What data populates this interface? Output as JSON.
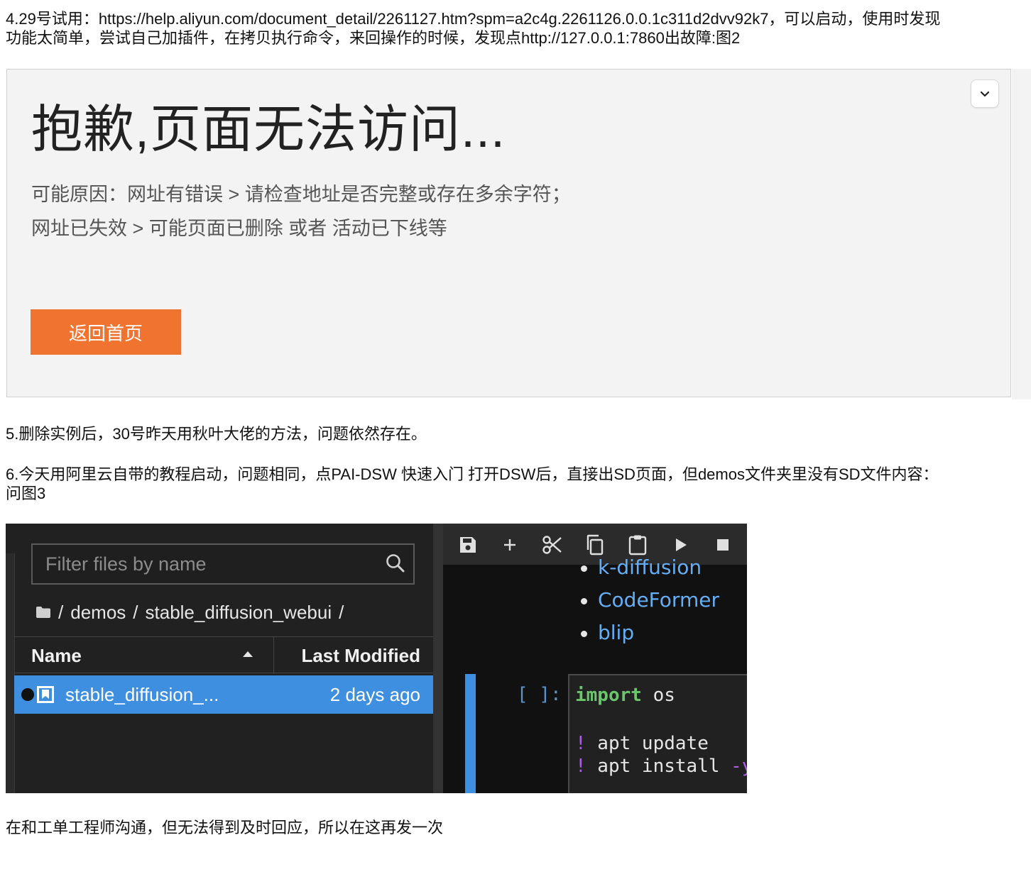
{
  "text": {
    "p1_line1": "4.29号试用：https://help.aliyun.com/document_detail/2261127.htm?spm=a2c4g.2261126.0.0.1c311d2dvv92k7，可以启动，使用时发现",
    "p1_line2": "功能太简单，尝试自己加插件，在拷贝执行命令，来回操作的时候，发现点http://127.0.0.1:7860出故障:图2",
    "p2": "5.删除实例后，30号昨天用秋叶大佬的方法，问题依然存在。",
    "p3_line1": "6.今天用阿里云自带的教程启动，问题相同，点PAI-DSW 快速入门 打开DSW后，直接出SD页面，但demos文件夹里没有SD文件内容：",
    "p3_line2": "问图3",
    "p4": "在和工单工程师沟通，但无法得到及时回应，所以在这再发一次"
  },
  "error_page": {
    "title": "抱歉,页面无法访问...",
    "reason_line1": "可能原因：网址有错误 > 请检查地址是否完整或存在多余字符；",
    "reason_line2": "网址已失效 > 可能页面已删除 或者 活动已下线等",
    "home_button": "返回首页",
    "accent_color": "#f07330"
  },
  "jupyter": {
    "filter_placeholder": "Filter files by name",
    "breadcrumb": [
      "/",
      "demos",
      "/",
      "stable_diffusion_webui",
      "/"
    ],
    "columns": {
      "name": "Name",
      "modified": "Last Modified"
    },
    "rows": [
      {
        "name": "stable_diffusion_...",
        "modified": "2 days ago",
        "selected": true
      }
    ],
    "toolbar": [
      "save-icon",
      "add-icon",
      "cut-icon",
      "copy-icon",
      "paste-icon",
      "run-icon",
      "stop-icon"
    ],
    "notebook": {
      "bullets": [
        "k-diffusion",
        "CodeFormer",
        "blip"
      ],
      "prompt": "[ ]:",
      "code": {
        "line1_kw": "import",
        "line1_rest": " os",
        "line3_bang": "!",
        "line3_rest": " apt update",
        "line4_bang": "!",
        "line4_rest": " apt install ",
        "line4_flag": "-y"
      }
    }
  }
}
